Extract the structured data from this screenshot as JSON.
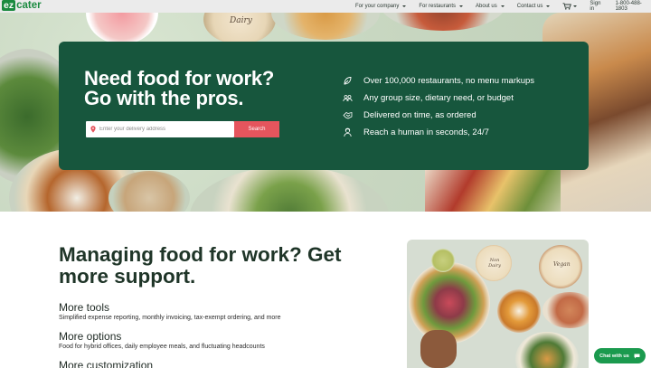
{
  "brand": {
    "logo_ez": "ez",
    "logo_rest": "cater"
  },
  "nav": {
    "items": [
      {
        "label": "For your company"
      },
      {
        "label": "For restaurants"
      },
      {
        "label": "About us"
      },
      {
        "label": "Contact us"
      }
    ],
    "cart_icon": "cart-icon",
    "signin": "Sign in",
    "phone": "1-800-488-1803"
  },
  "hero": {
    "title_line1": "Need food for work?",
    "title_line2": "Go with the pros.",
    "search": {
      "placeholder": "Enter your delivery address",
      "button": "Search",
      "icon": "location-pin-icon"
    },
    "features": [
      {
        "icon": "restaurant-icon",
        "text": "Over 100,000 restaurants, no menu markups"
      },
      {
        "icon": "group-icon",
        "text": "Any group size, dietary need, or budget"
      },
      {
        "icon": "delivery-icon",
        "text": "Delivered on time, as ordered"
      },
      {
        "icon": "support-icon",
        "text": "Reach a human in seconds, 24/7"
      }
    ],
    "photo_labels": {
      "dairy": "Dairy"
    }
  },
  "section": {
    "title": "Managing food for work? Get more support.",
    "items": [
      {
        "heading": "More tools",
        "text": "Simplified expense reporting, monthly invoicing, tax-exempt ordering, and more"
      },
      {
        "heading": "More options",
        "text": "Food for hybrid offices, daily employee meals, and fluctuating headcounts"
      },
      {
        "heading": "More customization",
        "text": ""
      }
    ],
    "photo_labels": {
      "non_dairy": "Non Dairy",
      "vegan": "Vegan"
    }
  },
  "chat": {
    "label": "Chat with us",
    "icon": "chat-bubble-icon"
  },
  "colors": {
    "brand_green": "#1a8a3f",
    "panel_green": "#17563d",
    "search_red": "#e5555d",
    "chat_green": "#1b9a4e"
  }
}
